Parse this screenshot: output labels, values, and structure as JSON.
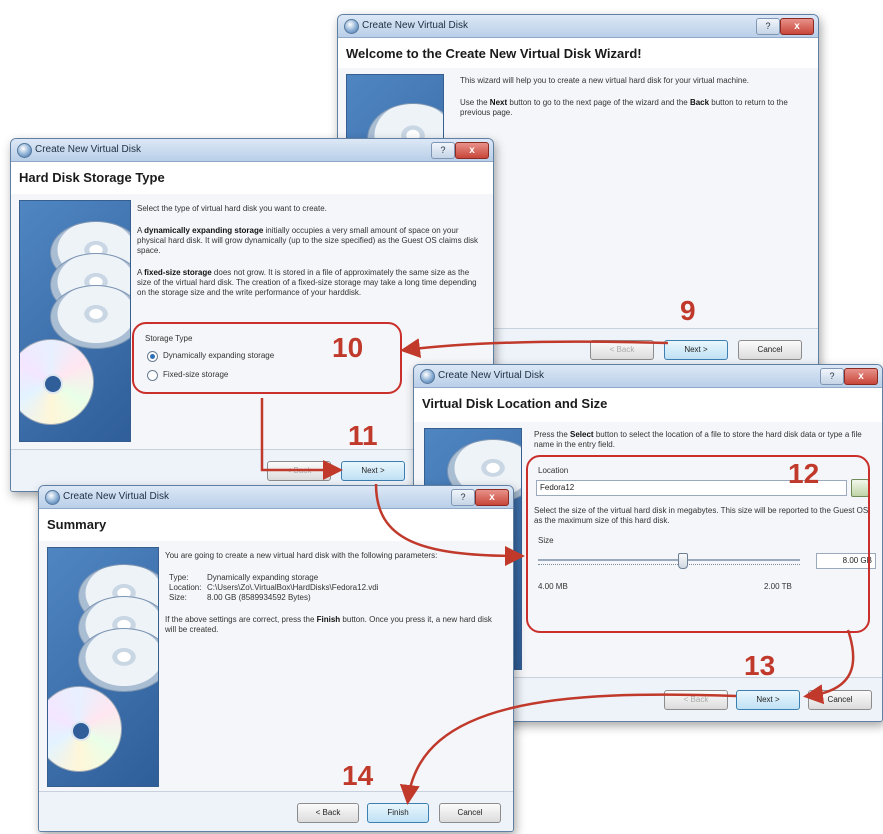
{
  "wizard_title": "Create New Virtual Disk",
  "close_glyph": "x",
  "help_glyph": "?",
  "windows": {
    "welcome": {
      "heading": "Welcome to the Create New Virtual Disk Wizard!",
      "p1": "This wizard will help you to create a new virtual hard disk for your virtual machine.",
      "p2_prefix": "Use the ",
      "p2_next": "Next",
      "p2_mid": " button to go to the next page of the wizard and the ",
      "p2_back": "Back",
      "p2_suffix": " button to return to the previous page.",
      "buttons": {
        "back": "< Back",
        "next": "Next >",
        "cancel": "Cancel"
      }
    },
    "storage_type": {
      "heading": "Hard Disk Storage Type",
      "intro": "Select the type of virtual hard disk you want to create.",
      "dyn_bold": "dynamically expanding storage",
      "dyn_text_a": "A ",
      "dyn_text_b": " initially occupies a very small amount of space on your physical hard disk. It will grow dynamically (up to the size specified) as the Guest OS claims disk space.",
      "fixed_bold": "fixed-size storage",
      "fixed_text_a": "A ",
      "fixed_text_b": " does not grow. It is stored in a file of approximately the same size as the size of the virtual hard disk. The creation of a fixed-size storage may take a long time depending on the storage size and the write performance of your harddisk.",
      "group_label": "Storage Type",
      "options": [
        "Dynamically expanding storage",
        "Fixed-size storage"
      ],
      "selected": "Dynamically expanding storage",
      "buttons": {
        "back": "< Back",
        "next": "Next >"
      }
    },
    "location": {
      "heading": "Virtual Disk Location and Size",
      "intro_a": "Press the ",
      "intro_bold": "Select",
      "intro_b": " button to select the location of a file to store the hard disk data or type a file name in the entry field.",
      "location_label": "Location",
      "location_value": "Fedora12",
      "size_intro": "Select the size of the virtual hard disk in megabytes. This size will be reported to the Guest OS as the maximum size of this hard disk.",
      "size_label": "Size",
      "size_value": "8.00 GB",
      "size_min": "4.00 MB",
      "size_max": "2.00 TB",
      "slider_fraction": 0.55,
      "buttons": {
        "back": "< Back",
        "next": "Next >",
        "cancel": "Cancel"
      }
    },
    "summary": {
      "heading": "Summary",
      "intro": "You are going to create a new virtual hard disk with the following parameters:",
      "rows": [
        {
          "key": "Type:",
          "value": "Dynamically expanding storage"
        },
        {
          "key": "Location:",
          "value": "C:\\Users\\Zo\\.VirtualBox\\HardDisks\\Fedora12.vdi"
        },
        {
          "key": "Size:",
          "value": "8.00 GB (8589934592 Bytes)"
        }
      ],
      "outro_a": "If the above settings are correct, press the ",
      "outro_bold": "Finish",
      "outro_b": " button. Once you press it, a new hard disk will be created.",
      "buttons": {
        "back": "< Back",
        "finish": "Finish",
        "cancel": "Cancel"
      }
    }
  },
  "steps": [
    "9",
    "10",
    "11",
    "12",
    "13",
    "14"
  ],
  "colors": {
    "annotation": "#c0392b",
    "title_bar": "#b9cfe8"
  }
}
